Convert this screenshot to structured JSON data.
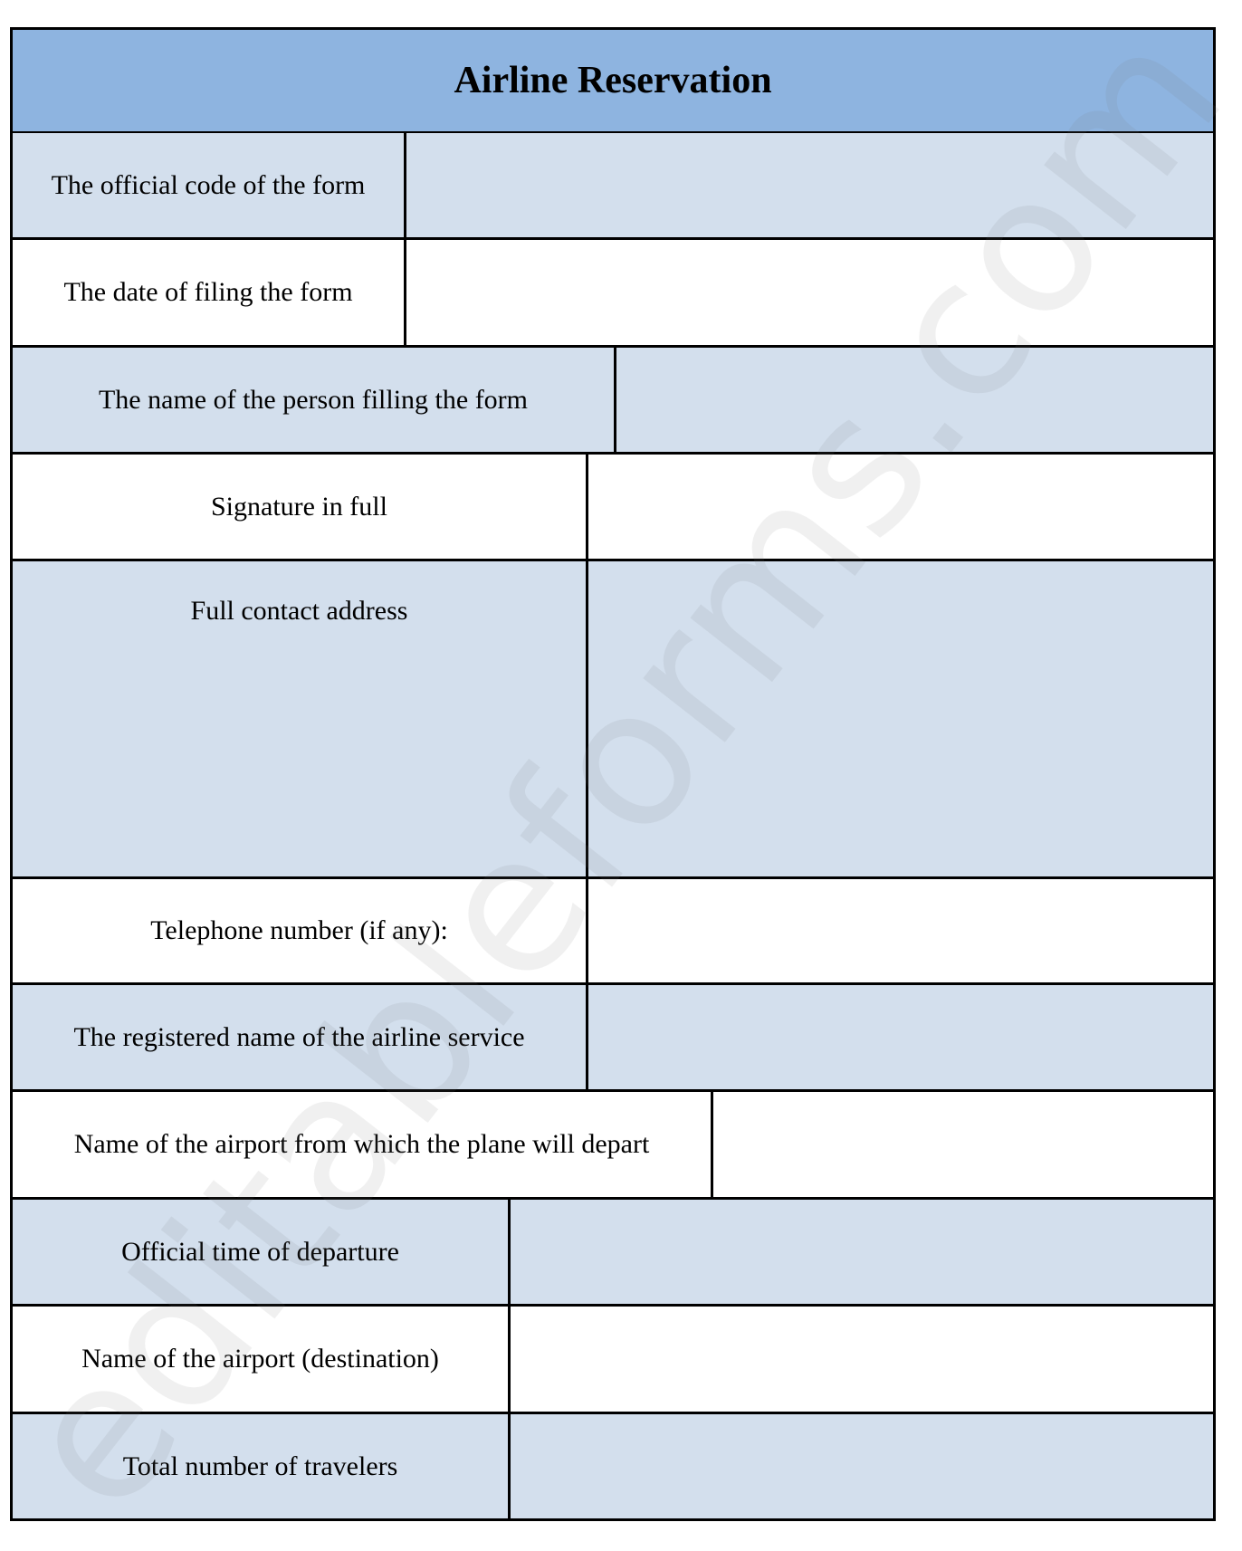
{
  "document": {
    "title": "Airline Reservation",
    "watermark": "editableforms.com",
    "colors": {
      "header_background": "#8EB4E0",
      "shaded_row": "#D3DFED",
      "plain_row": "#FFFFFF",
      "border": "#000000"
    },
    "fields": [
      {
        "label": "The official code of the form",
        "value": ""
      },
      {
        "label": "The date of filing the form",
        "value": ""
      },
      {
        "label": "The name of the person filling the form",
        "value": ""
      },
      {
        "label": "Signature in full",
        "value": ""
      },
      {
        "label": "Full contact address",
        "value": ""
      },
      {
        "label": "Telephone number (if any):",
        "value": ""
      },
      {
        "label": "The registered name of the airline service",
        "value": ""
      },
      {
        "label": "Name of the airport from which the plane will depart",
        "value": ""
      },
      {
        "label": "Official time of departure",
        "value": ""
      },
      {
        "label": "Name of the airport (destination)",
        "value": ""
      },
      {
        "label": "Total number of travelers",
        "value": ""
      }
    ]
  }
}
